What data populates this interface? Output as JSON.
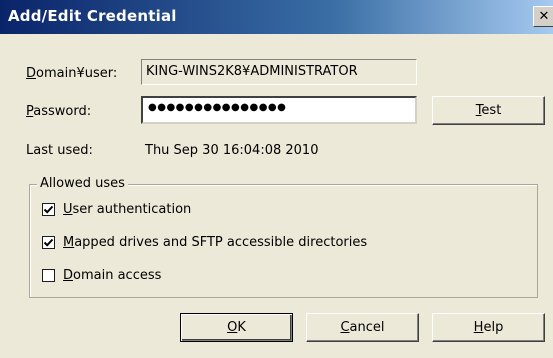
{
  "window": {
    "title": "Add/Edit Credential",
    "close_glyph": "✕"
  },
  "domain_user": {
    "label_prefix": "",
    "label_key": "D",
    "label_rest": "omain¥user:",
    "value": "KING-WINS2K8¥ADMINISTRATOR"
  },
  "password": {
    "label_key": "P",
    "label_rest": "assword:",
    "value": "●●●●●●●●●●●●●●●"
  },
  "test_button": {
    "key": "T",
    "rest": "est"
  },
  "last_used": {
    "label": "Last used:",
    "value": "Thu Sep 30 16:04:08 2010"
  },
  "allowed_uses": {
    "legend": "Allowed uses",
    "items": [
      {
        "key": "U",
        "rest": "ser authentication",
        "checked": true
      },
      {
        "key": "M",
        "rest": "apped drives and SFTP accessible directories",
        "checked": true
      },
      {
        "key": "D",
        "rest": "omain access",
        "checked": false
      }
    ]
  },
  "buttons": {
    "ok": {
      "key": "O",
      "rest": "K"
    },
    "cancel": {
      "key": "C",
      "rest": "ancel"
    },
    "help": {
      "key": "H",
      "rest": "elp"
    }
  },
  "icons": {
    "check": "check-icon",
    "close": "close-icon"
  }
}
